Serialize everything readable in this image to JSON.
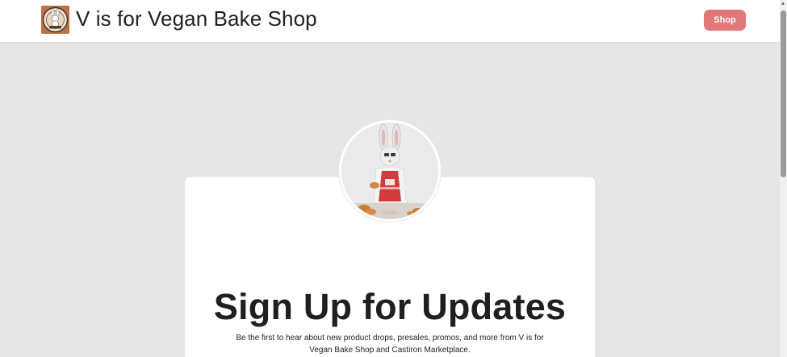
{
  "header": {
    "site_title": "V is for Vegan Bake Shop",
    "shop_button_label": "Shop",
    "logo_icon": "bakery-logo-icon"
  },
  "hero": {
    "avatar_icon": "bunny-baker-avatar",
    "title": "Sign Up for Updates",
    "description": "Be the first to hear about new product drops, presales, promos, and more from V is for Vegan Bake Shop and Castiron Marketplace."
  },
  "colors": {
    "accent": "#e2777a",
    "page_background": "#e6e6e7",
    "card_background": "#ffffff",
    "text": "#1f1f1f"
  }
}
